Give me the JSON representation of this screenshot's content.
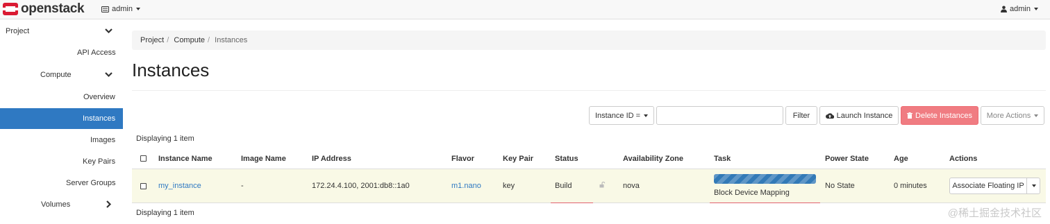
{
  "navbar": {
    "brand": "openstack",
    "project": "admin",
    "user": "admin"
  },
  "sidebar": {
    "items": [
      {
        "label": "Project"
      },
      {
        "label": "API Access"
      },
      {
        "label": "Compute"
      },
      {
        "label": "Overview"
      },
      {
        "label": "Instances"
      },
      {
        "label": "Images"
      },
      {
        "label": "Key Pairs"
      },
      {
        "label": "Server Groups"
      },
      {
        "label": "Volumes"
      }
    ]
  },
  "breadcrumb": [
    "Project",
    "Compute",
    "Instances"
  ],
  "page_title": "Instances",
  "toolbar": {
    "filter_field": "Instance ID =",
    "filter_value": "",
    "filter_label": "Filter",
    "launch_label": "Launch Instance",
    "delete_label": "Delete Instances",
    "more_label": "More Actions"
  },
  "display_count_top": "Displaying 1 item",
  "display_count_bottom": "Displaying 1 item",
  "table": {
    "headers": [
      "Instance Name",
      "Image Name",
      "IP Address",
      "Flavor",
      "Key Pair",
      "Status",
      "Availability Zone",
      "Task",
      "Power State",
      "Age",
      "Actions"
    ],
    "rows": [
      {
        "name": "my_instance",
        "image": "-",
        "ip": "172.24.4.100, 2001:db8::1a0",
        "flavor": "m1.nano",
        "key_pair": "key",
        "status": "Build",
        "zone": "nova",
        "task": "Block Device Mapping",
        "power_state": "No State",
        "age": "0 minutes",
        "action": "Associate Floating IP"
      }
    ]
  },
  "watermark": "@稀土掘金技术社区",
  "colors": {
    "accent": "#2f79c2",
    "danger": "#f07c82",
    "row_highlight": "#f9f9e6",
    "brand_red": "#da1a32"
  }
}
